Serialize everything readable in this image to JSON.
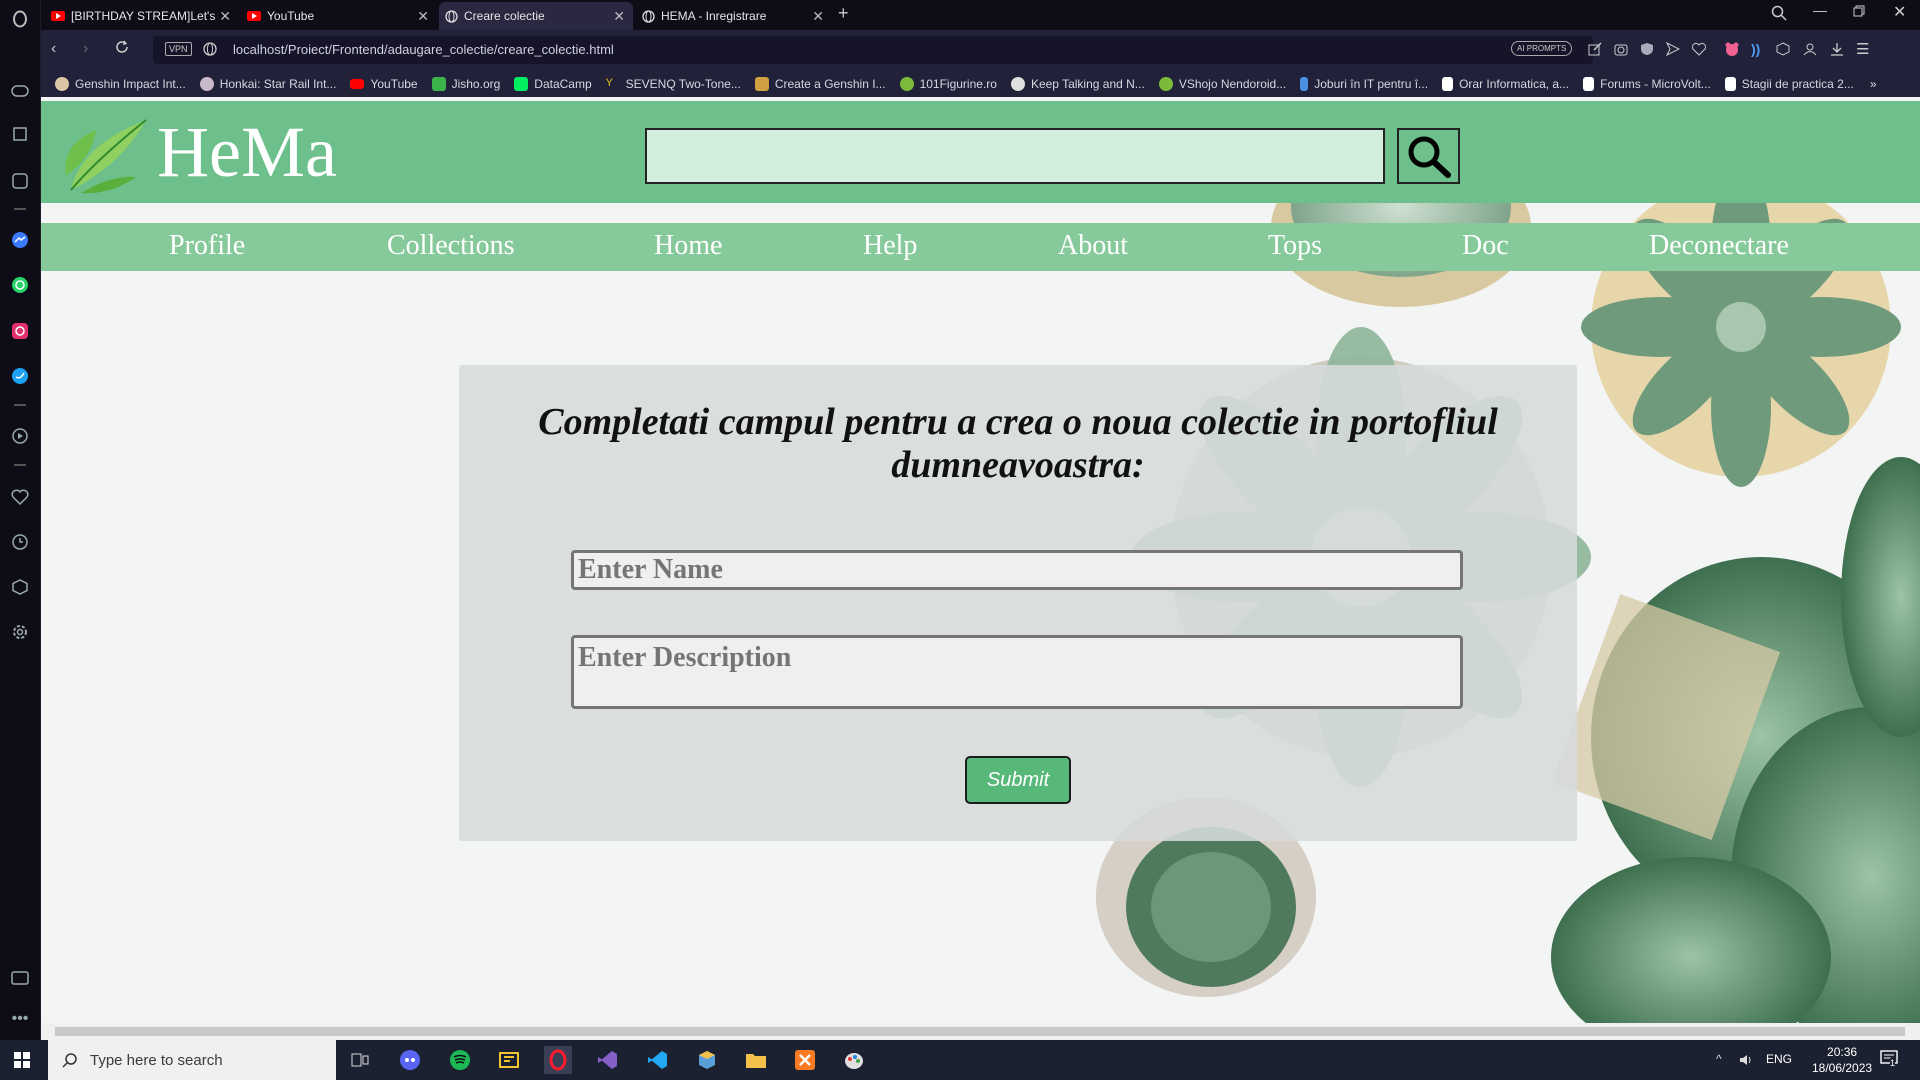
{
  "browser": {
    "tabs": [
      {
        "title": "[BIRTHDAY STREAM]Let's",
        "icon": "youtube-icon",
        "active": false
      },
      {
        "title": "YouTube",
        "icon": "youtube-icon",
        "active": false
      },
      {
        "title": "Creare colectie",
        "icon": "globe-icon",
        "active": true
      },
      {
        "title": "HEMA - Inregistrare",
        "icon": "globe-icon",
        "active": false
      }
    ],
    "new_tab": "+",
    "vpn_label": "VPN",
    "url": "localhost/Proiect/Frontend/adaugare_colectie/creare_colectie.html",
    "ai_prompts_label": "AI PROMPTS",
    "bookmarks": [
      {
        "label": "Genshin Impact Int...",
        "color": "#d9c7a8"
      },
      {
        "label": "Honkai: Star Rail Int...",
        "color": "#c8b8c8"
      },
      {
        "label": "YouTube",
        "color": "#ff0000"
      },
      {
        "label": "Jisho.org",
        "color": "#3bb34a"
      },
      {
        "label": "DataCamp",
        "color": "#03ef62"
      },
      {
        "label": "SEVENQ Two-Tone...",
        "color": "#e8c020"
      },
      {
        "label": "Create a Genshin I...",
        "color": "#d0a040"
      },
      {
        "label": "101Figurine.ro",
        "color": "#7cba3a"
      },
      {
        "label": "Keep Talking and N...",
        "color": "#e0e0e0"
      },
      {
        "label": "VShojo Nendoroid...",
        "color": "#7cba3a"
      },
      {
        "label": "Joburi în IT pentru î...",
        "color": "#4a90e2"
      },
      {
        "label": "Orar Informatica, a...",
        "color": "#ffffff"
      },
      {
        "label": "Forums - MicroVolt...",
        "color": "#ffffff"
      },
      {
        "label": "Stagii de practica 2...",
        "color": "#ffffff"
      }
    ],
    "bookmarks_more": "»"
  },
  "site": {
    "brand": "HeMa",
    "search_placeholder": "",
    "nav": [
      "Profile",
      "Collections",
      "Home",
      "Help",
      "About",
      "Tops",
      "Doc",
      "Deconectare"
    ]
  },
  "form": {
    "title": "Completati campul pentru a crea o noua colectie in portofliul dumneavoastra:",
    "name_placeholder": "Enter Name",
    "description_placeholder": "Enter Description",
    "submit_label": "Submit"
  },
  "taskbar": {
    "search_placeholder": "Type here to search",
    "language": "ENG",
    "time": "20:36",
    "date": "18/06/2023",
    "notification_count": "1"
  },
  "colors": {
    "header_green": "#6dc08c",
    "nav_green": "#86c99a",
    "submit_green": "#58b87a"
  }
}
